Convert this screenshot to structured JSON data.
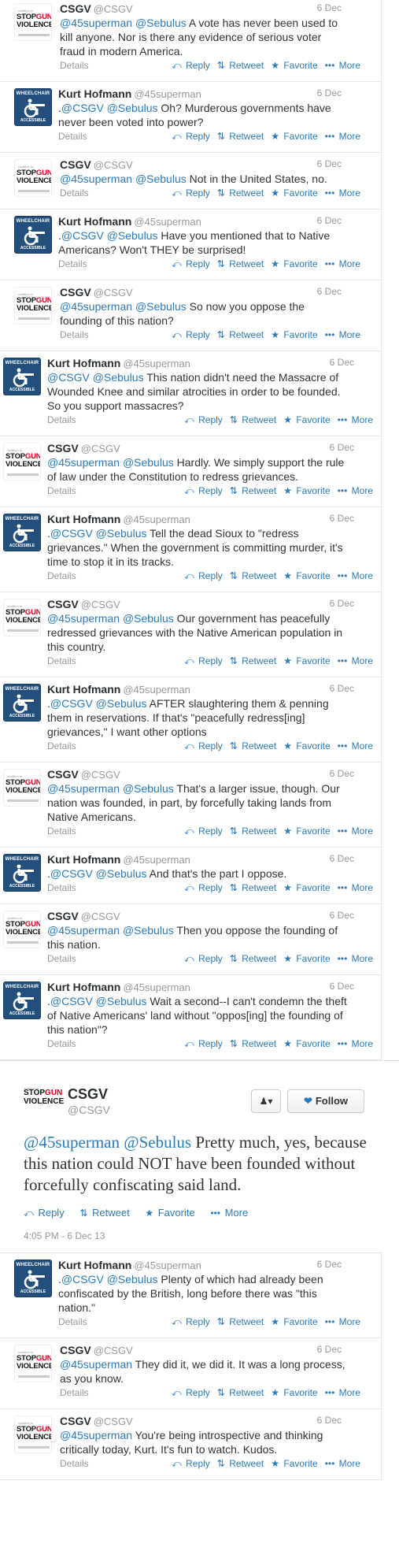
{
  "tweets_before": [
    {
      "user": "csgv",
      "name": "CSGV",
      "handle": "@CSGV",
      "time": "6 Dec",
      "parts": [
        [
          "m",
          "@45superman"
        ],
        [
          "t",
          " "
        ],
        [
          "m",
          "@Sebulus"
        ],
        [
          "t",
          " A vote has never been used to kill anyone. Nor is there any evidence of serious voter fraud in modern America."
        ]
      ],
      "show_name": true
    },
    {
      "user": "kurt",
      "name": "Kurt Hofmann",
      "handle": "@45superman",
      "time": "6 Dec",
      "parts": [
        [
          "t",
          "."
        ],
        [
          "m",
          "@CSGV"
        ],
        [
          "t",
          " "
        ],
        [
          "m",
          "@Sebulus"
        ],
        [
          "t",
          " Oh? Murderous governments have never been voted into power?"
        ]
      ]
    },
    {
      "user": "csgv",
      "name": "CSGV",
      "handle": "@CSGV",
      "time": "6 Dec",
      "parts": [
        [
          "m",
          "@45superman"
        ],
        [
          "t",
          " "
        ],
        [
          "m",
          "@Sebulus"
        ],
        [
          "t",
          " Not in the United States, no."
        ]
      ]
    },
    {
      "user": "kurt",
      "name": "Kurt Hofmann",
      "handle": "@45superman",
      "time": "6 Dec",
      "parts": [
        [
          "t",
          "."
        ],
        [
          "m",
          "@CSGV"
        ],
        [
          "t",
          " "
        ],
        [
          "m",
          "@Sebulus"
        ],
        [
          "t",
          " Have you mentioned that to Native Americans? Won't THEY be surprised!"
        ]
      ]
    },
    {
      "user": "csgv",
      "name": "CSGV",
      "handle": "@CSGV",
      "time": "6 Dec",
      "parts": [
        [
          "m",
          "@45superman"
        ],
        [
          "t",
          " "
        ],
        [
          "m",
          "@Sebulus"
        ],
        [
          "t",
          " So now you oppose the founding of this nation?"
        ]
      ]
    },
    {
      "user": "kurt",
      "name": "Kurt Hofmann",
      "handle": "@45superman",
      "time": "6 Dec",
      "shift": true,
      "parts": [
        [
          "m",
          "@CSGV"
        ],
        [
          "t",
          " "
        ],
        [
          "m",
          "@Sebulus"
        ],
        [
          "t",
          " This nation didn't need the Massacre of Wounded Knee and similar atrocities in order to be founded. So you support massacres?"
        ]
      ]
    },
    {
      "user": "csgv",
      "name": "CSGV",
      "handle": "@CSGV",
      "time": "6 Dec",
      "shift": true,
      "parts": [
        [
          "m",
          "@45superman"
        ],
        [
          "t",
          " "
        ],
        [
          "m",
          "@Sebulus"
        ],
        [
          "t",
          " Hardly. We simply support the rule of law under the Constitution to redress grievances."
        ]
      ]
    },
    {
      "user": "kurt",
      "name": "Kurt Hofmann",
      "handle": "@45superman",
      "time": "6 Dec",
      "shift": true,
      "parts": [
        [
          "t",
          "."
        ],
        [
          "m",
          "@CSGV"
        ],
        [
          "t",
          " "
        ],
        [
          "m",
          "@Sebulus"
        ],
        [
          "t",
          " Tell the dead Sioux to \"redress grievances.\" When the government is committing murder, it's time to stop it in its tracks."
        ]
      ]
    },
    {
      "user": "csgv",
      "name": "CSGV",
      "handle": "@CSGV",
      "time": "6 Dec",
      "shift": true,
      "parts": [
        [
          "m",
          "@45superman"
        ],
        [
          "t",
          " "
        ],
        [
          "m",
          "@Sebulus"
        ],
        [
          "t",
          " Our government has peacefully redressed grievances with the Native American population in this country."
        ]
      ]
    },
    {
      "user": "kurt",
      "name": "Kurt Hofmann",
      "handle": "@45superman",
      "time": "6 Dec",
      "shift": true,
      "parts": [
        [
          "t",
          "."
        ],
        [
          "m",
          "@CSGV"
        ],
        [
          "t",
          " "
        ],
        [
          "m",
          "@Sebulus"
        ],
        [
          "t",
          " AFTER slaughtering them & penning them in reservations. If that's \"peacefully redress[ing] grievances,\" I want other options"
        ]
      ]
    },
    {
      "user": "csgv",
      "name": "CSGV",
      "handle": "@CSGV",
      "time": "6 Dec",
      "shift": true,
      "parts": [
        [
          "m",
          "@45superman"
        ],
        [
          "t",
          " "
        ],
        [
          "m",
          "@Sebulus"
        ],
        [
          "t",
          " That's a larger issue, though. Our nation was founded, in part, by forcefully taking lands from Native Americans."
        ]
      ]
    },
    {
      "user": "kurt",
      "name": "Kurt Hofmann",
      "handle": "@45superman",
      "time": "6 Dec",
      "shift": true,
      "parts": [
        [
          "t",
          "."
        ],
        [
          "m",
          "@CSGV"
        ],
        [
          "t",
          " "
        ],
        [
          "m",
          "@Sebulus"
        ],
        [
          "t",
          " And that's the part I oppose."
        ]
      ]
    },
    {
      "user": "csgv",
      "name": "CSGV",
      "handle": "@CSGV",
      "time": "6 Dec",
      "shift": true,
      "parts": [
        [
          "m",
          "@45superman"
        ],
        [
          "t",
          " "
        ],
        [
          "m",
          "@Sebulus"
        ],
        [
          "t",
          " Then you oppose the founding of this nation."
        ]
      ]
    },
    {
      "user": "kurt",
      "name": "Kurt Hofmann",
      "handle": "@45superman",
      "time": "6 Dec",
      "shift": true,
      "parts": [
        [
          "t",
          "."
        ],
        [
          "m",
          "@CSGV"
        ],
        [
          "t",
          " "
        ],
        [
          "m",
          "@Sebulus"
        ],
        [
          "t",
          " Wait a second--I can't condemn the theft of Native Americans' land without \"oppos[ing] the founding of this nation\"?"
        ]
      ]
    }
  ],
  "expanded": {
    "name": "CSGV",
    "handle": "@CSGV",
    "follow_label": "Follow",
    "parts": [
      [
        "m",
        "@45superman"
      ],
      [
        "t",
        " "
      ],
      [
        "m",
        "@Sebulus"
      ],
      [
        "t",
        " Pretty much, yes, because this nation could NOT have been founded without forcefully confiscating said land."
      ]
    ],
    "reply": "Reply",
    "retweet": "Retweet",
    "favorite": "Favorite",
    "more": "More",
    "timestamp": "4:05 PM - 6 Dec 13"
  },
  "tweets_after": [
    {
      "user": "kurt",
      "name": "Kurt Hofmann",
      "handle": "@45superman",
      "time": "6 Dec",
      "parts": [
        [
          "t",
          "."
        ],
        [
          "m",
          "@CSGV"
        ],
        [
          "t",
          " "
        ],
        [
          "m",
          "@Sebulus"
        ],
        [
          "t",
          " Plenty of which had already been confiscated by the British, long before there was \"this nation.\""
        ]
      ]
    },
    {
      "user": "csgv",
      "name": "CSGV",
      "handle": "@CSGV",
      "time": "6 Dec",
      "parts": [
        [
          "m",
          "@45superman"
        ],
        [
          "t",
          " They did it, we did it. It was a long process, as you know."
        ]
      ]
    },
    {
      "user": "csgv",
      "name": "CSGV",
      "handle": "@CSGV",
      "time": "6 Dec",
      "parts": [
        [
          "m",
          "@45superman"
        ],
        [
          "t",
          " You're being introspective and thinking critically today, Kurt. It's fun to watch. Kudos."
        ]
      ]
    }
  ],
  "action_labels": {
    "details": "Details",
    "reply": "Reply",
    "retweet": "Retweet",
    "favorite": "Favorite",
    "more": "More"
  },
  "avatar_text": {
    "sgv_top": "coalition to",
    "sgv_line1": "STOP",
    "sgv_line1_red": "GUN",
    "sgv_line2": "VIOLENCE",
    "wc_top": "WHEELCHAIR",
    "wc_bottom": "ACCESSIBLE"
  },
  "icons": {
    "reply": "reply-arrow-icon",
    "retweet": "retweet-icon",
    "favorite": "star-icon",
    "more": "ellipsis-icon",
    "follow": "twitter-bird-icon",
    "user": "user-menu-icon"
  },
  "colors": {
    "link": "#2b7bb9",
    "muted": "#999999",
    "brand_red": "#d0021b",
    "wheelchair_blue": "#234f7d"
  }
}
